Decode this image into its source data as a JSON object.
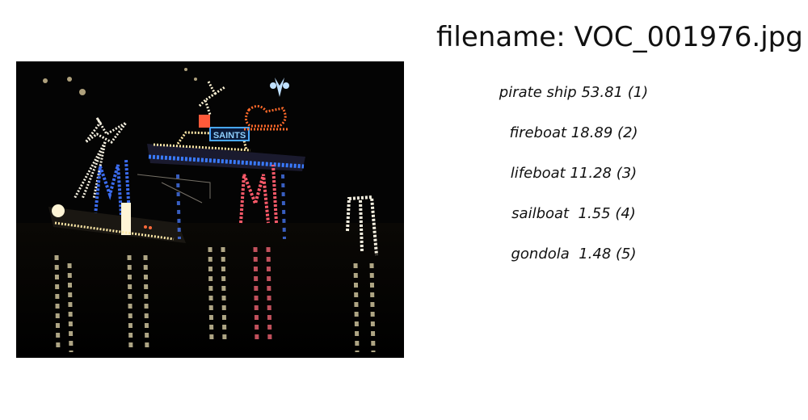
{
  "header": {
    "filename": "filename: VOC_001976.jpg"
  },
  "image": {
    "alt": "boat parade at night with holiday lights",
    "text_sign": "SAINTS"
  },
  "predictions": [
    {
      "label": "pirate ship 53.81 (1)"
    },
    {
      "label": "fireboat 18.89 (2)"
    },
    {
      "label": "lifeboat 11.28 (3)"
    },
    {
      "label": "sailboat  1.55 (4)"
    },
    {
      "label": "gondola  1.48 (5)"
    }
  ],
  "colors": {
    "background": "#ffffff",
    "text": "#111111",
    "photo_bg": "#050505"
  }
}
